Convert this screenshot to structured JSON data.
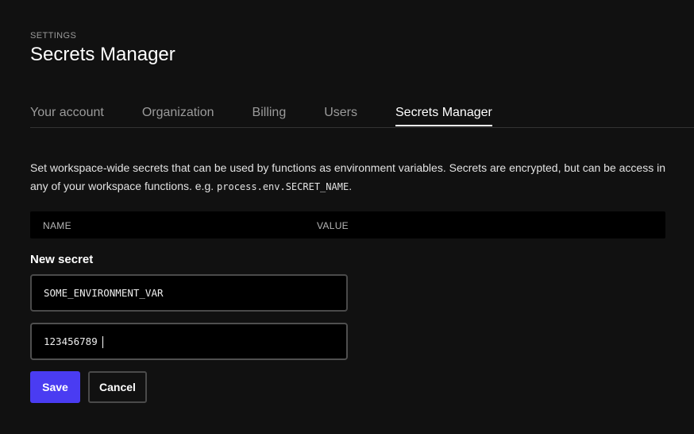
{
  "header": {
    "eyebrow": "SETTINGS",
    "title": "Secrets Manager"
  },
  "tabs": [
    {
      "label": "Your account",
      "active": false
    },
    {
      "label": "Organization",
      "active": false
    },
    {
      "label": "Billing",
      "active": false
    },
    {
      "label": "Users",
      "active": false
    },
    {
      "label": "Secrets Manager",
      "active": true
    }
  ],
  "description": {
    "text": "Set workspace-wide secrets that can be used by functions as environment variables. Secrets are encrypted, but can be access in any of your workspace functions. e.g. ",
    "code": "process.env.SECRET_NAME",
    "suffix": "."
  },
  "table": {
    "columns": [
      "NAME",
      "VALUE"
    ],
    "rows": []
  },
  "new_secret": {
    "title": "New secret",
    "name_value": "SOME_ENVIRONMENT_VAR",
    "value_value": "123456789",
    "save_label": "Save",
    "cancel_label": "Cancel"
  },
  "colors": {
    "background": "#111111",
    "primary_button": "#4a3cf2",
    "input_background": "#000000",
    "border": "#4a4a4a"
  }
}
